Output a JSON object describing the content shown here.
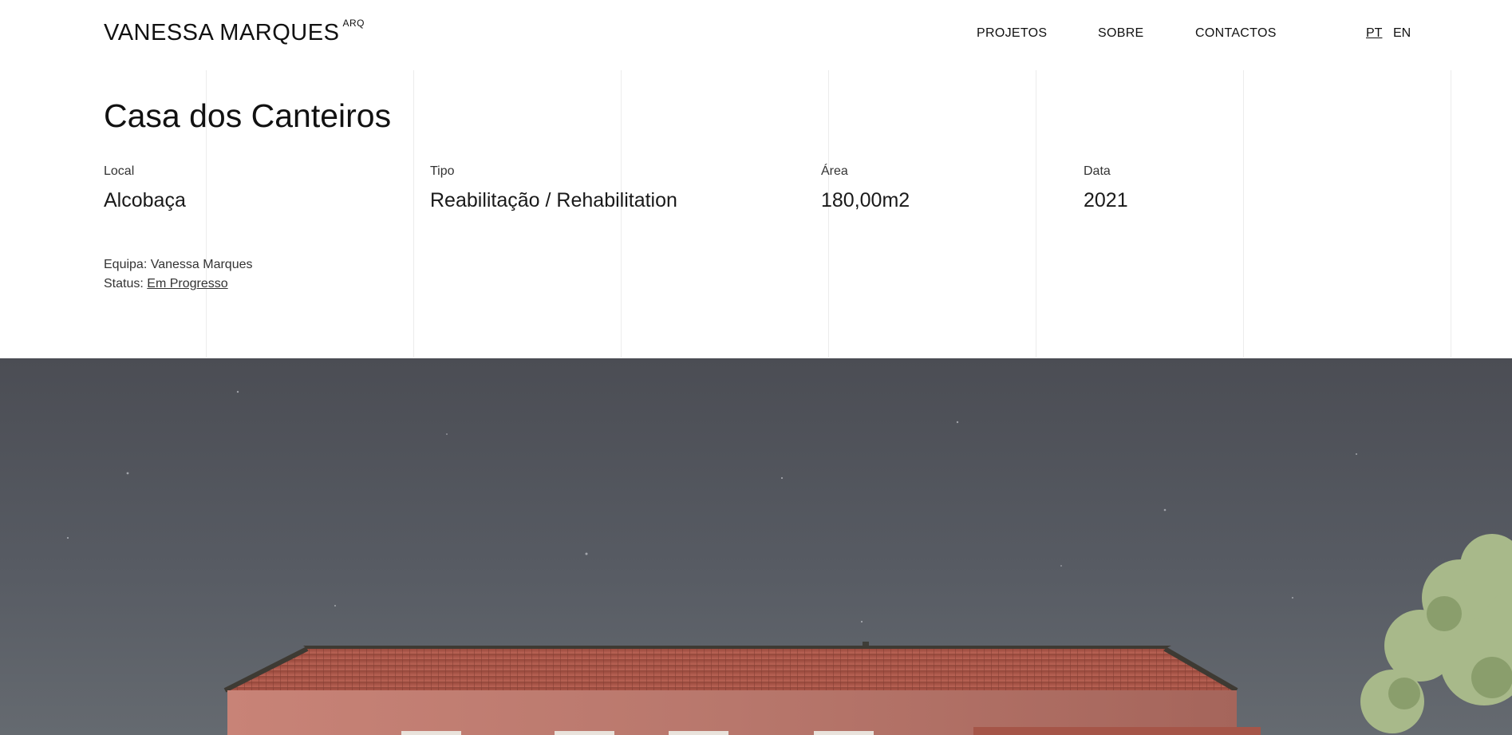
{
  "header": {
    "logo": "VANESSA MARQUES",
    "logo_suffix": "ARQ",
    "nav": [
      {
        "label": "PROJETOS"
      },
      {
        "label": "SOBRE"
      },
      {
        "label": "CONTACTOS"
      }
    ],
    "languages": [
      {
        "label": "PT",
        "active": true
      },
      {
        "label": "EN",
        "active": false
      }
    ]
  },
  "project": {
    "title": "Casa dos Canteiros",
    "meta": [
      {
        "label": "Local",
        "value": "Alcobaça"
      },
      {
        "label": "Tipo",
        "value": "Reabilitação / Rehabilitation"
      },
      {
        "label": "Área",
        "value": "180,00m2"
      },
      {
        "label": "Data",
        "value": "2021"
      }
    ],
    "team_label": "Equipa:",
    "team_value": "Vanessa Marques",
    "status_label": "Status:",
    "status_value": "Em Progresso"
  },
  "hero": {
    "icon": "house-render-image",
    "sky_color": "#4c4e55",
    "roof_color": "#b35a4a",
    "wall_color": "#b6786e",
    "tree_color": "#a9b88a"
  }
}
